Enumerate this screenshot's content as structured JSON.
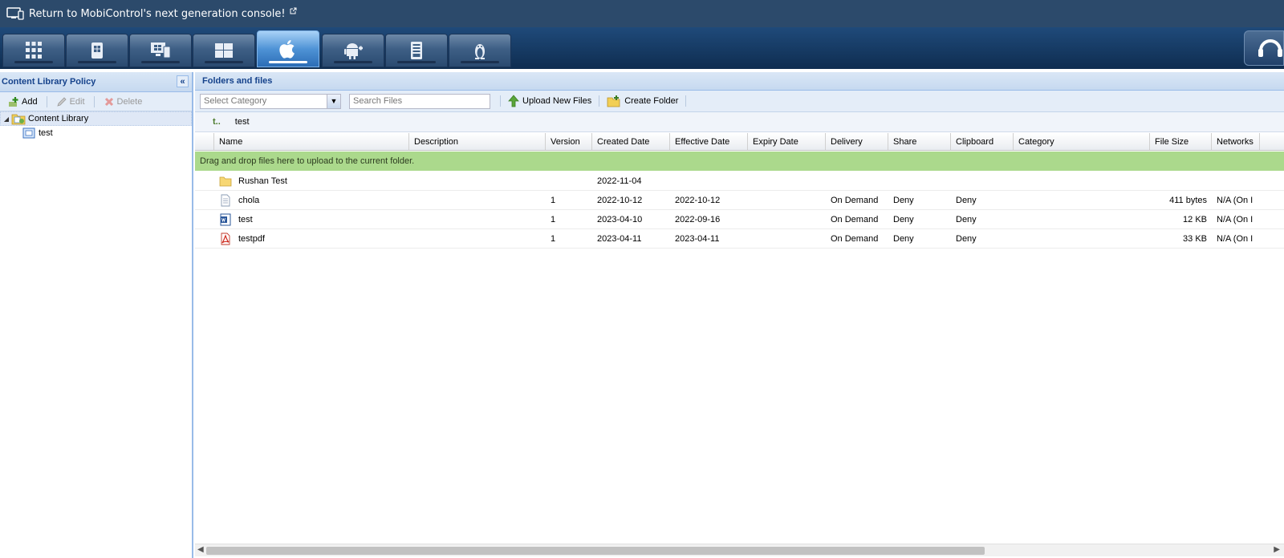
{
  "banner": {
    "text": "Return to MobiControl's next generation console!",
    "ext_icon": "external-link-icon"
  },
  "platform_tabs": [
    {
      "icon": "grid-apps-icon",
      "active": false
    },
    {
      "icon": "windows-mobile-icon",
      "active": false
    },
    {
      "icon": "windows-desktop-icon",
      "active": false
    },
    {
      "icon": "windows-modern-icon",
      "active": false
    },
    {
      "icon": "apple-icon",
      "active": true
    },
    {
      "icon": "android-plus-icon",
      "active": false
    },
    {
      "icon": "printer-device-icon",
      "active": false
    },
    {
      "icon": "linux-icon",
      "active": false
    }
  ],
  "left_panel": {
    "title": "Content Library Policy",
    "toolbar": {
      "add": "Add",
      "edit": "Edit",
      "delete": "Delete"
    },
    "tree": {
      "root": "Content Library",
      "child": "test"
    }
  },
  "right_panel": {
    "title": "Folders and files",
    "toolbar": {
      "category_placeholder": "Select Category",
      "search_placeholder": "Search Files",
      "upload": "Upload New Files",
      "create_folder": "Create Folder"
    },
    "breadcrumb": {
      "up": "t..",
      "current": "test"
    },
    "columns": [
      "Name",
      "Description",
      "Version",
      "Created Date",
      "Effective Date",
      "Expiry Date",
      "Delivery",
      "Share",
      "Clipboard",
      "Category",
      "File Size",
      "Networks"
    ],
    "dropzone": "Drag and drop files here to upload to the current folder.",
    "rows": [
      {
        "icon": "folder-icon",
        "name": "Rushan Test",
        "description": "",
        "version": "",
        "created": "2022-11-04",
        "effective": "",
        "expiry": "",
        "delivery": "",
        "share": "",
        "clipboard": "",
        "category": "",
        "size": "",
        "networks": ""
      },
      {
        "icon": "text-file-icon",
        "name": "chola",
        "description": "",
        "version": "1",
        "created": "2022-10-12",
        "effective": "2022-10-12",
        "expiry": "",
        "delivery": "On Demand",
        "share": "Deny",
        "clipboard": "Deny",
        "category": "",
        "size": "411 bytes",
        "networks": "N/A (On I"
      },
      {
        "icon": "word-file-icon",
        "name": "test",
        "description": "",
        "version": "1",
        "created": "2023-04-10",
        "effective": "2022-09-16",
        "expiry": "",
        "delivery": "On Demand",
        "share": "Deny",
        "clipboard": "Deny",
        "category": "",
        "size": "12 KB",
        "networks": "N/A (On I"
      },
      {
        "icon": "pdf-file-icon",
        "name": "testpdf",
        "description": "",
        "version": "1",
        "created": "2023-04-11",
        "effective": "2023-04-11",
        "expiry": "",
        "delivery": "On Demand",
        "share": "Deny",
        "clipboard": "Deny",
        "category": "",
        "size": "33 KB",
        "networks": "N/A (On I"
      }
    ]
  }
}
